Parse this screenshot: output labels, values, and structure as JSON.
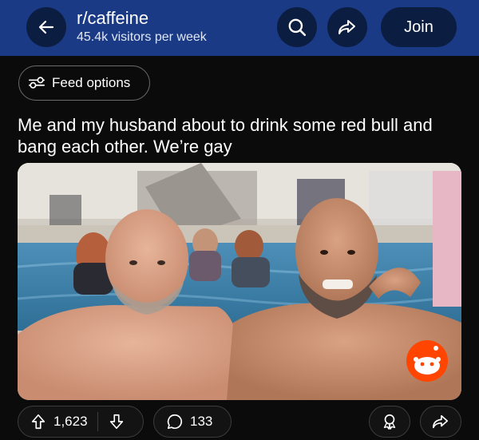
{
  "header": {
    "subreddit": "r/caffeine",
    "visitors": "45.4k visitors per week",
    "join_label": "Join",
    "bg_color": "#1b3a86"
  },
  "feed_options": {
    "label": "Feed options"
  },
  "post": {
    "title": "Me and my husband about to drink some red bull and bang each other. We’re gay",
    "upvotes": "1,623",
    "comments": "133"
  },
  "icons": {
    "back": "arrow-left-icon",
    "search": "search-icon",
    "share": "share-arrow-icon",
    "feed": "sliders-icon",
    "upvote": "upvote-arrow-icon",
    "downvote": "downvote-arrow-icon",
    "comment": "comment-bubble-icon",
    "award": "award-icon",
    "reddit_logo": "reddit-snoo-icon"
  }
}
